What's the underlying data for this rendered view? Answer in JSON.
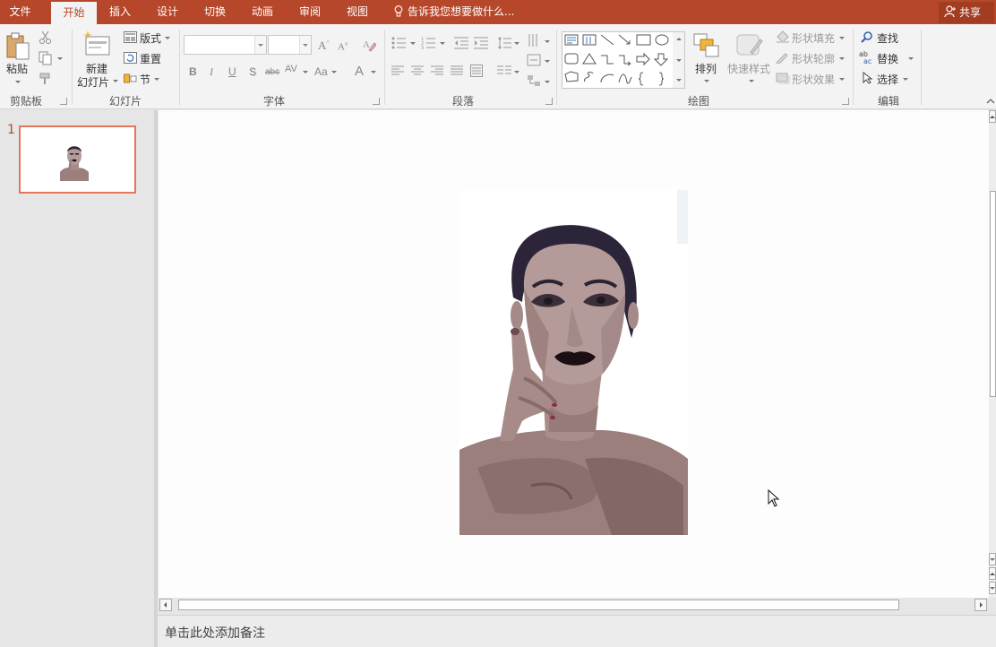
{
  "tabs": [
    "文件",
    "开始",
    "插入",
    "设计",
    "切换",
    "动画",
    "审阅",
    "视图"
  ],
  "active_tab": "开始",
  "tell_me": "告诉我您想要做什么...",
  "share": "共享",
  "colors": {
    "accent": "#b7472a",
    "selected_border": "#e5755a"
  },
  "ribbon": {
    "clipboard": {
      "label": "剪贴板",
      "paste": "粘贴"
    },
    "slides": {
      "label": "幻灯片",
      "new_slide_1": "新建",
      "new_slide_2": "幻灯片",
      "layout": "版式",
      "reset": "重置",
      "section": "节"
    },
    "font": {
      "label": "字体",
      "font_name": "",
      "font_size": ""
    },
    "paragraph": {
      "label": "段落"
    },
    "drawing": {
      "label": "绘图",
      "arrange": "排列",
      "quick_styles": "快速样式",
      "shape_fill": "形状填充",
      "shape_outline": "形状轮廓",
      "shape_effects": "形状效果"
    },
    "editing": {
      "label": "编辑",
      "find": "查找",
      "replace": "替换",
      "select": "选择"
    }
  },
  "slide_pane": {
    "slide_number": "1"
  },
  "notes_placeholder": "单击此处添加备注"
}
